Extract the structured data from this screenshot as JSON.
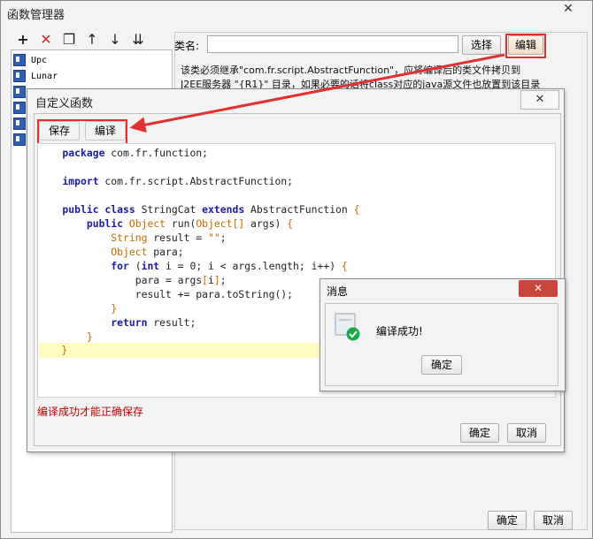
{
  "outer": {
    "title": "函数管理器",
    "close_glyph": "✕",
    "toolbar_icons": [
      "add-icon",
      "delete-icon",
      "copy-icon",
      "up-arrow-icon",
      "down-arrow-icon",
      "sort-icon"
    ],
    "items": [
      {
        "label": "Upc"
      },
      {
        "label": "Lunar"
      },
      {
        "label": ""
      },
      {
        "label": ""
      },
      {
        "label": ""
      },
      {
        "label": ""
      }
    ],
    "class_label": "类名:",
    "class_value": "",
    "select_label": "选择",
    "edit_label": "编辑",
    "hint": "该类必须继承\"com.fr.script.AbstractFunction\"，应将编译后的类文件拷贝到\nJ2EE服务器 \"{R1}\" 目录，如果必要的话将class对应的java源文件也放置到该目录\n下，",
    "ok_label": "确定",
    "cancel_label": "取消"
  },
  "inner": {
    "title": "自定义函数",
    "close_glyph": "✕",
    "save_label": "保存",
    "compile_label": "编译",
    "status_note": "编译成功才能正确保存",
    "ok_label": "确定",
    "cancel_label": "取消"
  },
  "code_lines": [
    "    package com.fr.function;",
    "",
    "    import com.fr.script.AbstractFunction;",
    "",
    "    public class StringCat extends AbstractFunction {",
    "        public Object run(Object[] args) {",
    "            String result = \"\";",
    "            Object para;",
    "            for (int i = 0; i < args.length; i++) {",
    "                para = args[i];",
    "                result += para.toString();",
    "            }",
    "            return result;",
    "        }",
    "    }"
  ],
  "message": {
    "title": "消息",
    "close_glyph": "✕",
    "text": "编译成功!",
    "ok_label": "确定"
  },
  "colors": {
    "keyword": "#1a1aa6",
    "type": "#c56a00",
    "highlight": "#e03030",
    "status": "#c00000",
    "success": "#1aa84a"
  }
}
